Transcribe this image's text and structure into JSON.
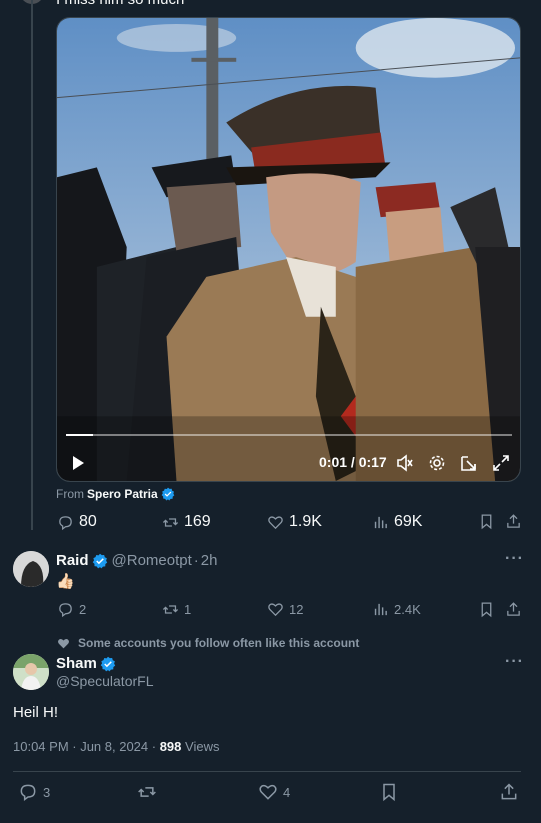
{
  "thread_top": {
    "partial_text": "I miss him so much"
  },
  "video": {
    "time_display": "0:01 / 0:17",
    "progress": 0.06,
    "icons": [
      "play-icon",
      "volume-icon",
      "settings-icon",
      "pop-out-icon",
      "fullscreen-icon"
    ]
  },
  "source": {
    "prefix": "From",
    "name": "Spero Patria"
  },
  "main_tweet_stats": {
    "replies": "80",
    "reposts": "169",
    "likes": "1.9K",
    "views": "69K"
  },
  "reply": {
    "name": "Raid",
    "handle": "@Romeotpt",
    "sep": "·",
    "time": "2h",
    "content": "👍🏻",
    "stats": {
      "replies": "2",
      "reposts": "1",
      "likes": "12",
      "views": "2.4K"
    }
  },
  "social_context": "Some accounts you follow often like this account",
  "focused_tweet": {
    "name": "Sham",
    "handle": "@SpeculatorFL",
    "text": "Heil H!",
    "timestamp": "10:04 PM · Jun 8, 2024 · ",
    "views_count": "898",
    "views_label": " Views",
    "stats": {
      "replies": "3",
      "reposts": "",
      "likes": "4"
    }
  },
  "colors": {
    "background": "#15202b",
    "muted": "#8b98a5",
    "verified_blue": "#1d9bf0",
    "border": "#38444d"
  }
}
